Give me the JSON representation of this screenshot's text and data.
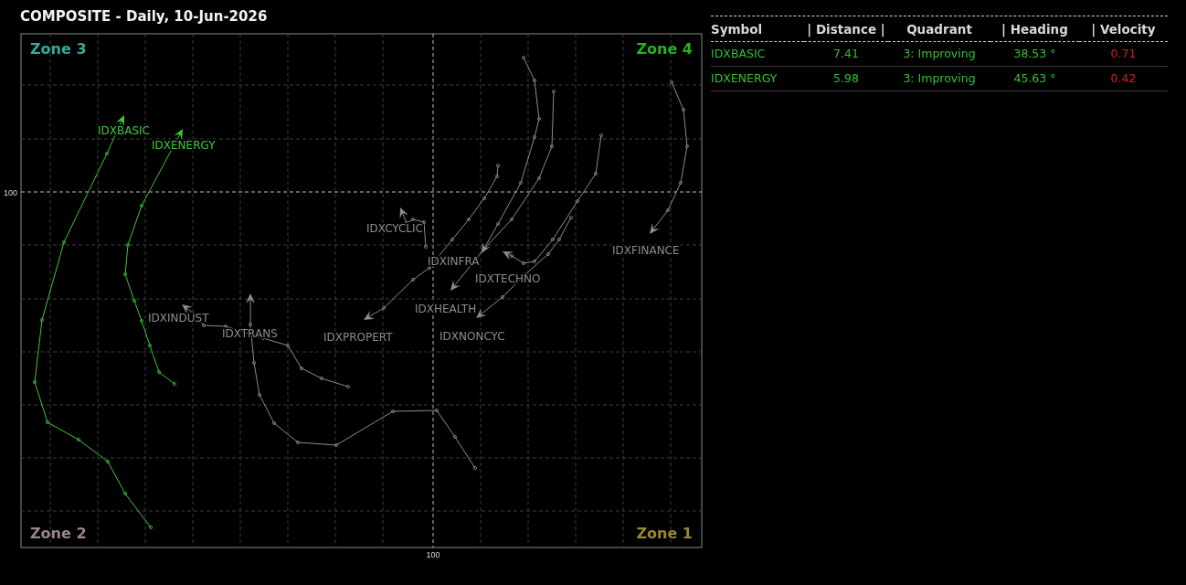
{
  "title": "COMPOSITE - Daily, 10-Jun-2026",
  "chart": {
    "y_axis_label": "100",
    "x_axis_label": "100",
    "zones": [
      {
        "label": "Zone 3",
        "color": "#3aa89a"
      },
      {
        "label": "Zone 4",
        "color": "#22b422"
      },
      {
        "label": "Zone 2",
        "color": "#9a8686"
      },
      {
        "label": "Zone 1",
        "color": "#968a2e"
      }
    ],
    "sectors": [
      {
        "label": "IDXBASIC",
        "color": "#3ec83e"
      },
      {
        "label": "IDXENERGY",
        "color": "#3ec83e"
      },
      {
        "label": "IDXCYCLIC",
        "color": "#8c8c8c"
      },
      {
        "label": "IDXFINANCE",
        "color": "#8c8c8c"
      },
      {
        "label": "IDXINFRA",
        "color": "#8c8c8c"
      },
      {
        "label": "IDXTECHNO",
        "color": "#8c8c8c"
      },
      {
        "label": "IDXHEALTH",
        "color": "#8c8c8c"
      },
      {
        "label": "IDXINDUST",
        "color": "#8c8c8c"
      },
      {
        "label": "IDXTRANS",
        "color": "#8c8c8c"
      },
      {
        "label": "IDXPROPERT",
        "color": "#8c8c8c"
      },
      {
        "label": "IDXNONCYC",
        "color": "#8c8c8c"
      }
    ]
  },
  "table": {
    "columns": [
      "Symbol",
      "| Distance |",
      "Quadrant",
      "| Heading",
      "| Velocity"
    ],
    "rows": [
      {
        "symbol": "IDXBASIC",
        "distance": "7.41",
        "quadrant": "3: Improving",
        "heading": "38.53 °",
        "velocity": "0.71"
      },
      {
        "symbol": "IDXENERGY",
        "distance": "5.98",
        "quadrant": "3: Improving",
        "heading": "45.63 °",
        "velocity": "0.42"
      }
    ]
  }
}
